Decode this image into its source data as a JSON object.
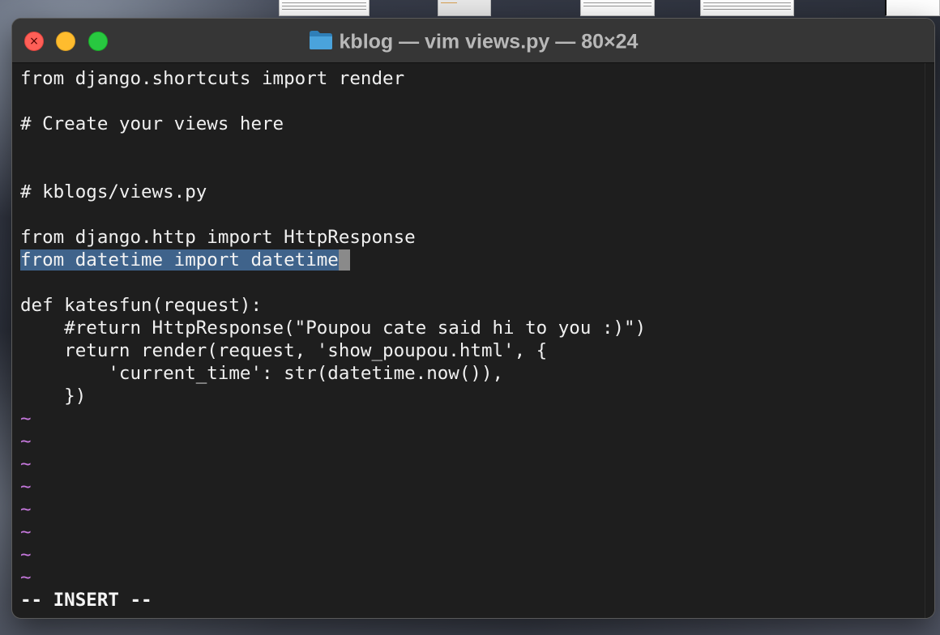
{
  "window": {
    "title": "kblog — vim views.py — 80×24",
    "folder_icon": "folder-icon",
    "controls": [
      "close",
      "minimize",
      "zoom"
    ],
    "control_colors": {
      "close": "#ff5f57",
      "minimize": "#febc2e",
      "zoom": "#28c840"
    }
  },
  "editor": {
    "lines": [
      "from django.shortcuts import render",
      "",
      "# Create your views here",
      "",
      "",
      "# kblogs/views.py",
      "",
      "from django.http import HttpResponse",
      "from datetime import datetime",
      "",
      "def katesfun(request):",
      "    #return HttpResponse(\"Poupou cate said hi to you :)\")",
      "    return render(request, 'show_poupou.html', {",
      "        'current_time': str(datetime.now()),",
      "    })"
    ],
    "selected_line": "from datetime import datetime",
    "empty_line_marker": "~",
    "empty_lines": [
      "~",
      "~",
      "~",
      "~",
      "~",
      "~",
      "~",
      "~"
    ],
    "mode_label": "-- INSERT --",
    "colors": {
      "background": "#1e1e1e",
      "text": "#f0f0f0",
      "selection": "#3f638b",
      "tilde": "#c678dd",
      "cursor": "#8a8a8a"
    }
  }
}
